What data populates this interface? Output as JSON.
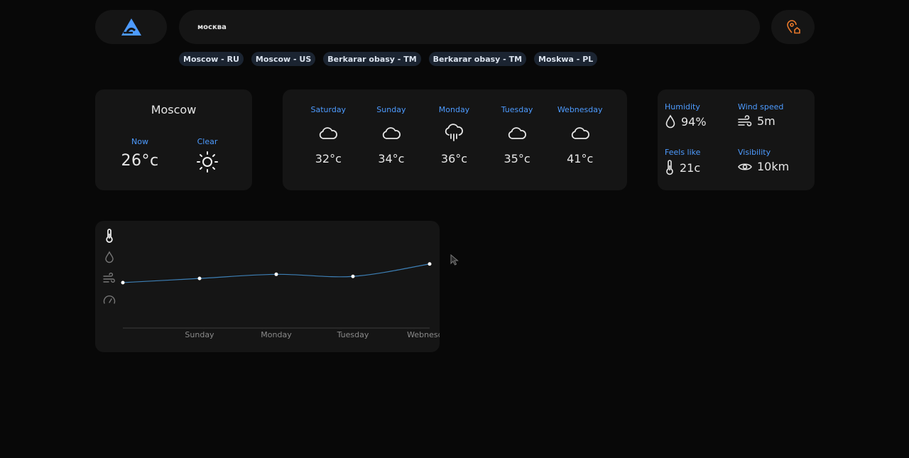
{
  "header": {
    "logo_icon": "triangle-logo",
    "search": {
      "value": "москва",
      "placeholder": ""
    },
    "location_button_icon": "map-pin-home-icon"
  },
  "suggestions": [
    "Moscow - RU",
    "Moscow - US",
    "Berkarar obasy - TM",
    "Berkarar obasy - TM",
    "Moskwa - PL"
  ],
  "current": {
    "city": "Moscow",
    "now_label": "Now",
    "temp": "26°c",
    "condition": "Clear",
    "condition_icon": "sun-icon"
  },
  "forecast": [
    {
      "day": "Saturday",
      "icon": "cloud-icon",
      "temp": "32°c"
    },
    {
      "day": "Sunday",
      "icon": "cloud-icon",
      "temp": "34°c"
    },
    {
      "day": "Monday",
      "icon": "cloud-rain-icon",
      "temp": "36°c"
    },
    {
      "day": "Tuesday",
      "icon": "cloud-icon",
      "temp": "35°c"
    },
    {
      "day": "Webnesday",
      "icon": "cloud-icon",
      "temp": "41°c"
    }
  ],
  "stats": {
    "humidity": {
      "label": "Humidity",
      "value": "94%"
    },
    "wind": {
      "label": "Wind speed",
      "value": "5m"
    },
    "feels": {
      "label": "Feels like",
      "value": "21c"
    },
    "visibility": {
      "label": "Visibility",
      "value": "10km"
    }
  },
  "chart_tools": [
    "thermometer-icon",
    "droplet-icon",
    "wind-icon",
    "gauge-icon"
  ],
  "colors": {
    "accent": "#4d9bff",
    "card": "#151515",
    "background": "#080808",
    "location_icon": "#e8782a",
    "chart_line": "#3d7fb5"
  },
  "chart_data": {
    "type": "line",
    "categories": [
      "Saturday",
      "Sunday",
      "Monday",
      "Tuesday",
      "Webnesday"
    ],
    "tick_labels": [
      "",
      "Sunday",
      "Monday",
      "Tuesday",
      "Webnesday"
    ],
    "series": [
      {
        "values": [
          32,
          34,
          36,
          35,
          41
        ]
      }
    ],
    "title": "",
    "xlabel": "",
    "ylabel": "",
    "ylim": [
      10,
      55
    ],
    "grid": false
  }
}
